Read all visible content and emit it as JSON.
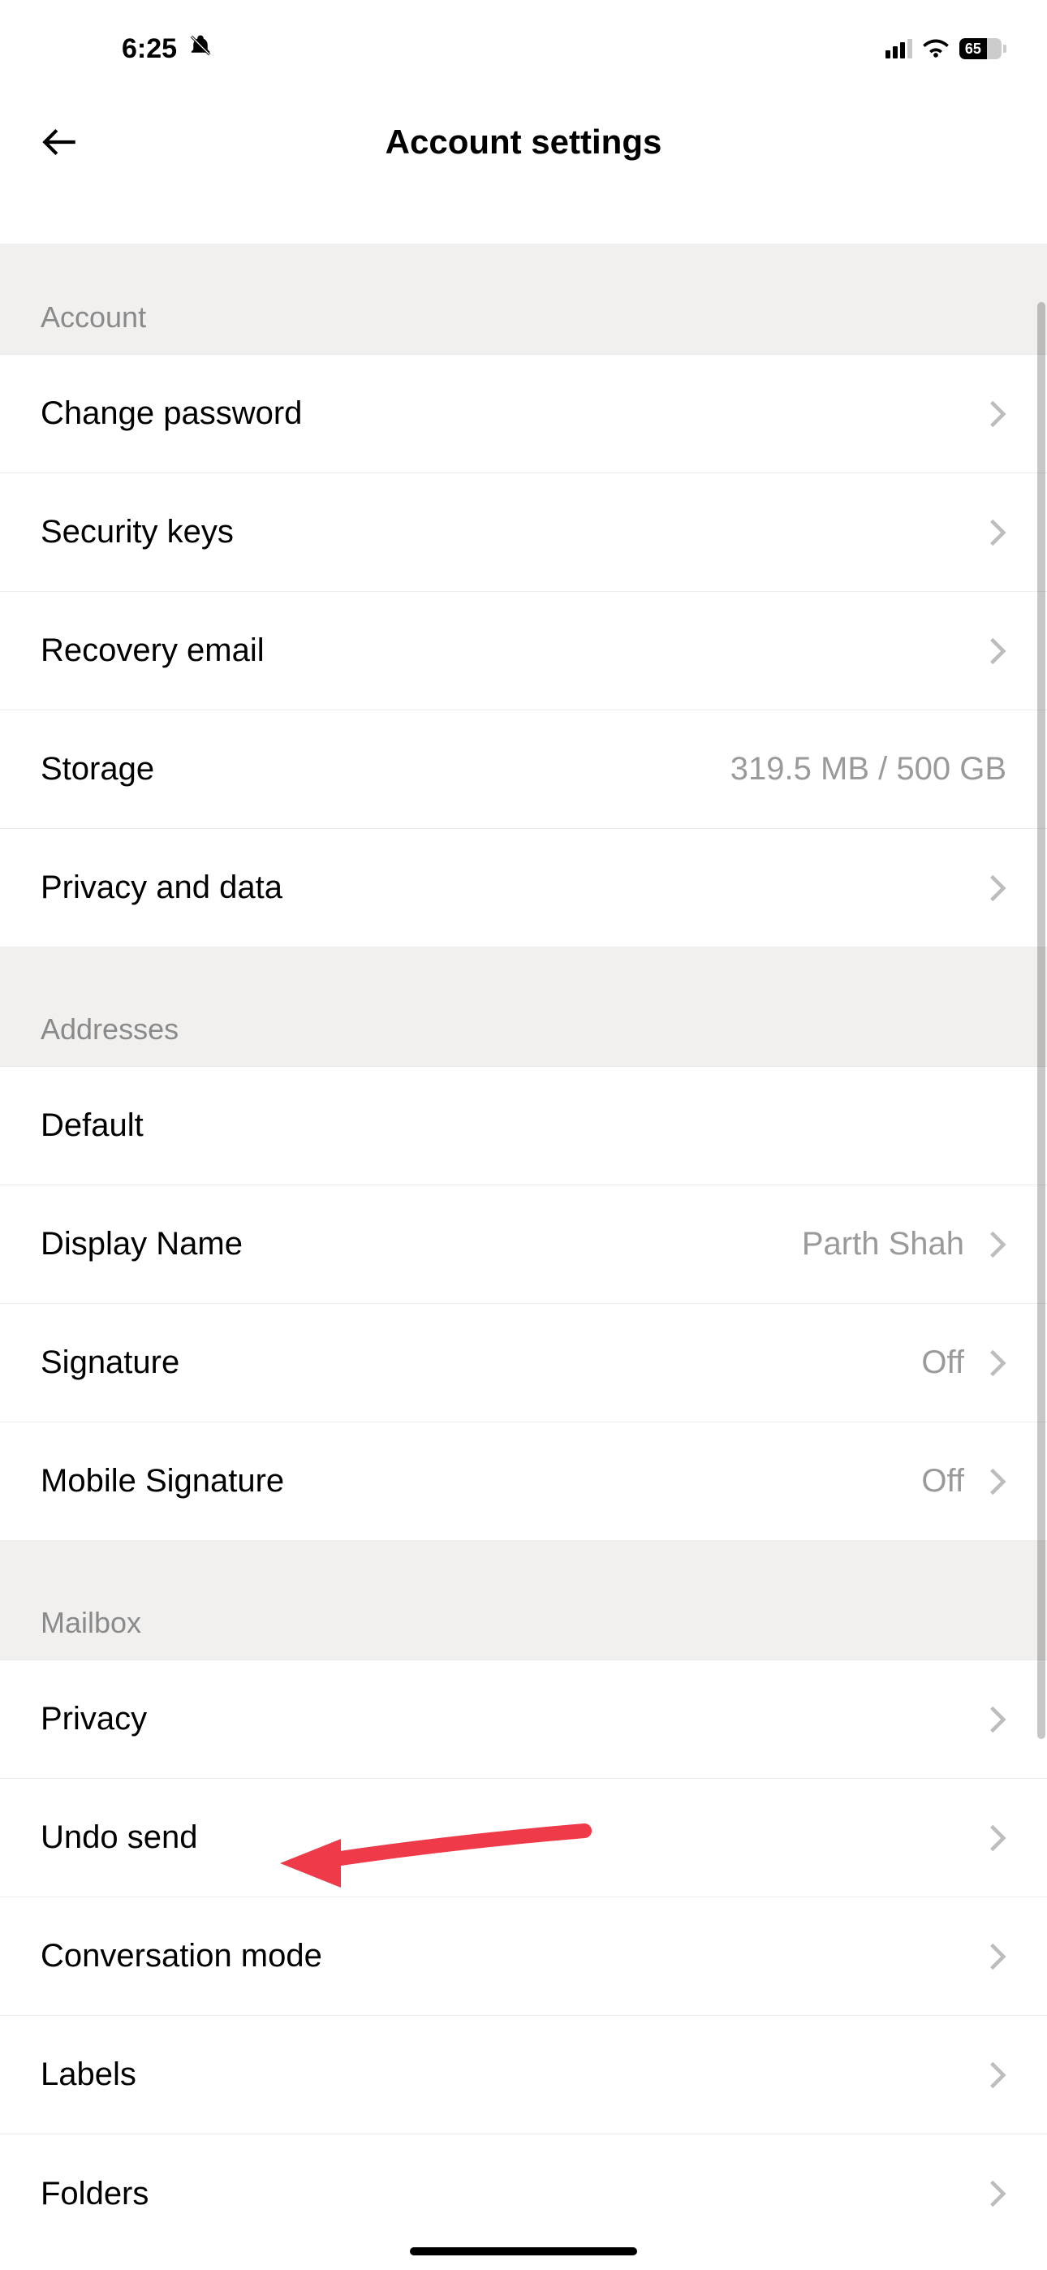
{
  "status": {
    "time": "6:25",
    "battery": "65"
  },
  "header": {
    "title": "Account settings"
  },
  "sections": {
    "account": {
      "header": "Account",
      "change_password": "Change password",
      "security_keys": "Security keys",
      "recovery_email": "Recovery email",
      "storage_label": "Storage",
      "storage_value": "319.5 MB / 500 GB",
      "privacy_data": "Privacy and data"
    },
    "addresses": {
      "header": "Addresses",
      "default_label": "Default",
      "default_value": "",
      "display_name_label": "Display Name",
      "display_name_value": "Parth Shah",
      "signature_label": "Signature",
      "signature_value": "Off",
      "mobile_signature_label": "Mobile Signature",
      "mobile_signature_value": "Off"
    },
    "mailbox": {
      "header": "Mailbox",
      "privacy": "Privacy",
      "undo_send": "Undo send",
      "conversation_mode": "Conversation mode",
      "labels": "Labels",
      "folders": "Folders"
    }
  }
}
